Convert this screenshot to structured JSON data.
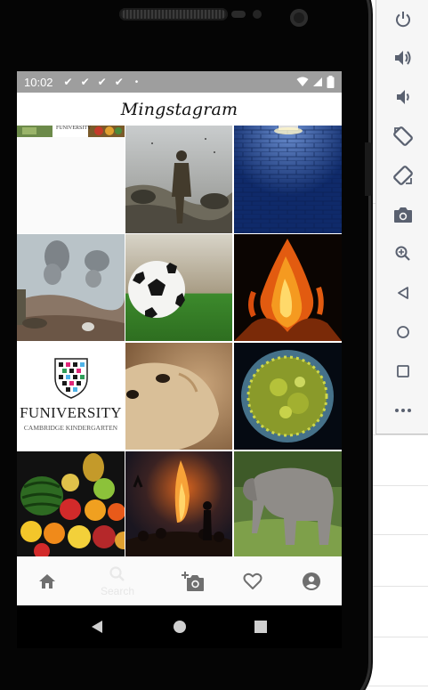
{
  "status_bar": {
    "time": "10:02",
    "notifications": [
      "✔",
      "✔",
      "✔",
      "✔"
    ],
    "dot": "•"
  },
  "app": {
    "title": "Mingstagram"
  },
  "grid": {
    "tiles": [
      {
        "id": "partial-funiversity",
        "label": "FUNIVERSITY"
      },
      {
        "id": "soldier-battlefield"
      },
      {
        "id": "brick-wall-lamp"
      },
      {
        "id": "smoke-rubble"
      },
      {
        "id": "soccer-ball"
      },
      {
        "id": "bonfire"
      },
      {
        "id": "funiversity-logo",
        "title": "FUNIVERSITY",
        "subtitle": "CAMBRIDGE KINDERGARTEN"
      },
      {
        "id": "meerkat"
      },
      {
        "id": "virus-cell"
      },
      {
        "id": "fruit-pile"
      },
      {
        "id": "campfire-night"
      },
      {
        "id": "elephant"
      }
    ]
  },
  "bottom_nav": {
    "items": [
      {
        "name": "home",
        "icon": "home-icon"
      },
      {
        "name": "search",
        "icon": "search-icon",
        "label": "Search"
      },
      {
        "name": "add-photo",
        "icon": "add-photo-icon"
      },
      {
        "name": "favorites",
        "icon": "heart-icon"
      },
      {
        "name": "profile",
        "icon": "account-icon"
      }
    ]
  },
  "android_nav": [
    "back-icon",
    "home-circle-icon",
    "recents-icon"
  ],
  "emulator_panel": {
    "buttons": [
      "power-icon",
      "volume-up-icon",
      "volume-down-icon",
      "rotate-left-icon",
      "rotate-right-icon",
      "camera-icon",
      "zoom-icon",
      "back-icon",
      "home-icon",
      "overview-icon",
      "more-icon"
    ]
  },
  "colors": {
    "status_bar": "#9e9e9e",
    "icon_grey": "#6f6f6f",
    "panel_icon": "#5a6170"
  }
}
